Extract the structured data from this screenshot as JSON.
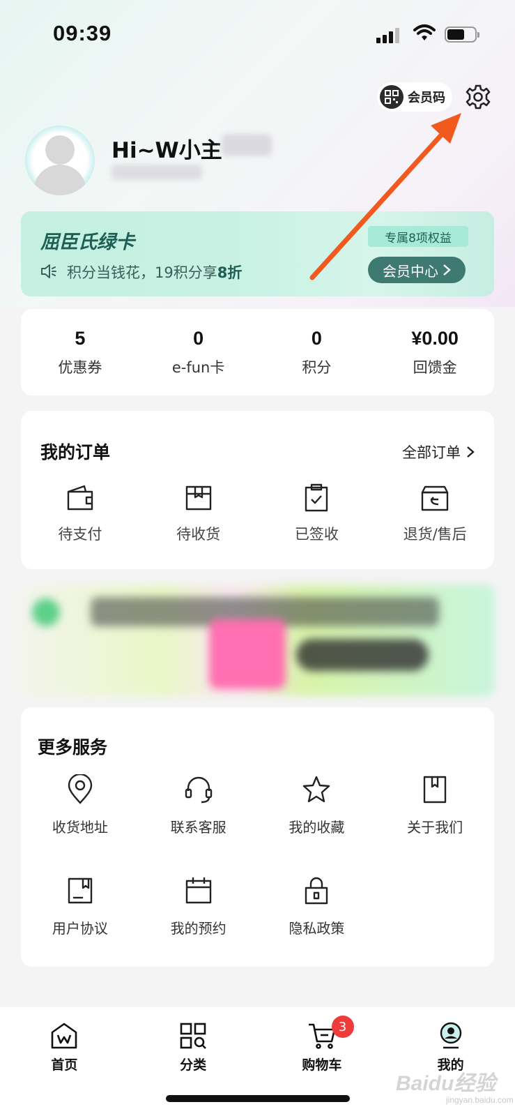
{
  "status_bar": {
    "time": "09:39"
  },
  "header": {
    "member_code_label": "会员码",
    "greeting": "Hi~W小主"
  },
  "green_card": {
    "title": "屈臣氏绿卡",
    "subtitle_prefix": "积分当钱花，19积分享",
    "subtitle_highlight": "8折",
    "badge": "专属8项权益",
    "button": "会员中心"
  },
  "stats": [
    {
      "value": "5",
      "label": "优惠券"
    },
    {
      "value": "0",
      "label": "e-fun卡"
    },
    {
      "value": "0",
      "label": "积分"
    },
    {
      "value": "¥0.00",
      "label": "回馈金"
    }
  ],
  "orders": {
    "title": "我的订单",
    "all_label": "全部订单",
    "items": [
      {
        "label": "待支付",
        "icon": "wallet-icon"
      },
      {
        "label": "待收货",
        "icon": "box-icon"
      },
      {
        "label": "已签收",
        "icon": "clipboard-check-icon"
      },
      {
        "label": "退货/售后",
        "icon": "return-box-icon"
      }
    ]
  },
  "services": {
    "title": "更多服务",
    "items": [
      {
        "label": "收货地址",
        "icon": "location-pin-icon"
      },
      {
        "label": "联系客服",
        "icon": "headset-icon"
      },
      {
        "label": "我的收藏",
        "icon": "star-icon"
      },
      {
        "label": "关于我们",
        "icon": "bookmark-book-icon"
      },
      {
        "label": "用户协议",
        "icon": "document-icon"
      },
      {
        "label": "我的预约",
        "icon": "calendar-icon"
      },
      {
        "label": "隐私政策",
        "icon": "lock-icon"
      }
    ]
  },
  "tabbar": {
    "items": [
      {
        "label": "首页",
        "icon": "home-icon"
      },
      {
        "label": "分类",
        "icon": "category-grid-icon"
      },
      {
        "label": "购物车",
        "icon": "cart-icon"
      },
      {
        "label": "我的",
        "icon": "profile-icon"
      }
    ],
    "cart_count": "3"
  },
  "watermark": {
    "text": "Baidu经验",
    "sub": "jingyan.baidu.com"
  },
  "colors": {
    "accent_green": "#1e5f55",
    "arrow": "#f05a1e",
    "badge_red": "#ef3b3b"
  }
}
